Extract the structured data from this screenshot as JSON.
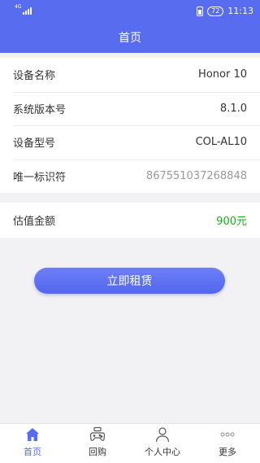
{
  "status_bar": {
    "network": "4G",
    "battery": "72",
    "time": "11:13"
  },
  "header": {
    "title": "首页"
  },
  "device_info": [
    {
      "label": "设备名称",
      "value": "Honor 10"
    },
    {
      "label": "系统版本号",
      "value": "8.1.0"
    },
    {
      "label": "设备型号",
      "value": "COL-AL10"
    },
    {
      "label": "唯一标识符",
      "value": "867551037268848"
    }
  ],
  "valuation": {
    "label": "估值金额",
    "value": "900元"
  },
  "rent_button": {
    "label": "立即租赁"
  },
  "tabs": [
    {
      "label": "首页",
      "icon": "home-icon",
      "active": true
    },
    {
      "label": "回购",
      "icon": "gamepad-icon",
      "active": false
    },
    {
      "label": "个人中心",
      "icon": "person-icon",
      "active": false
    },
    {
      "label": "更多",
      "icon": "more-icon",
      "active": false
    }
  ],
  "colors": {
    "primary": "#586cf0",
    "price": "#1aad19",
    "background": "#f2f2f4"
  }
}
